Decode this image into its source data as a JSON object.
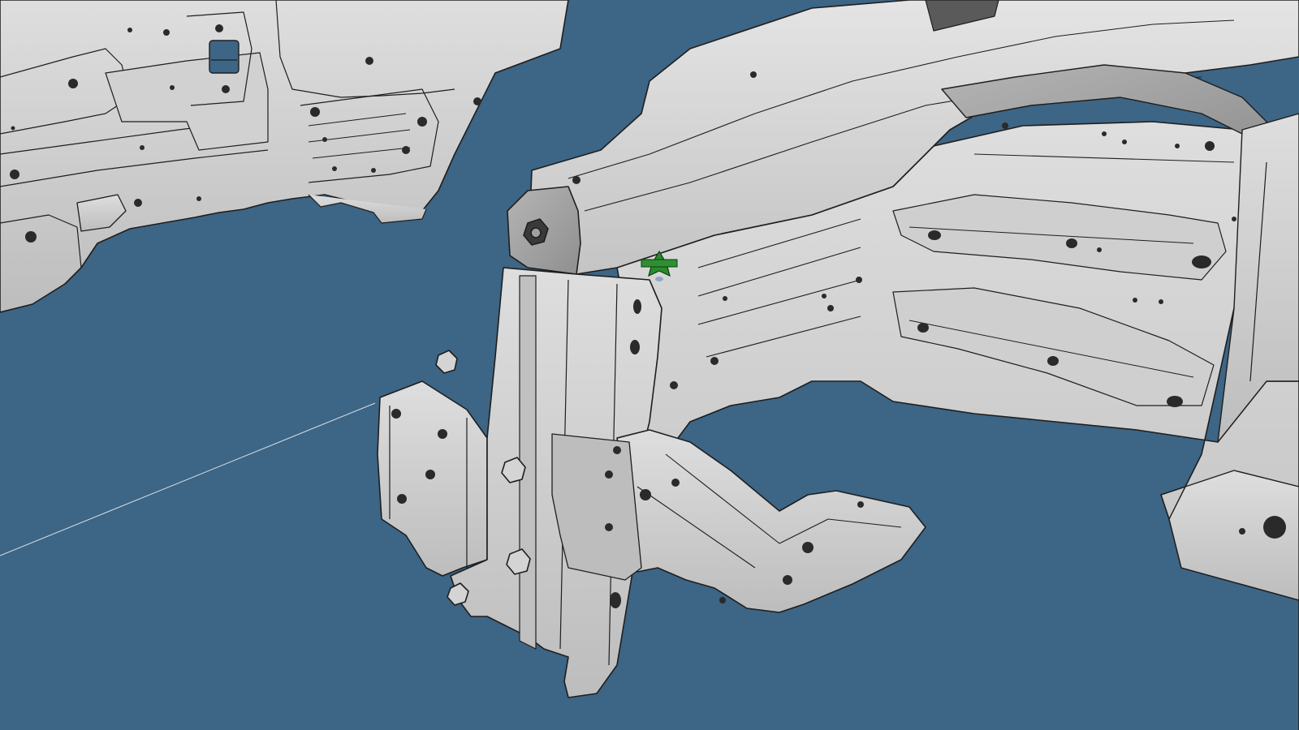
{
  "viewer": {
    "background_color": "#3d6585",
    "part_fill_color": "#c9c9c9",
    "part_shadow_color": "#9d9d9d",
    "part_edge_color": "#1e1e1e",
    "highlight_marker_color": "#2a8a2e",
    "highlight_marker_icon": "green-star-marker-icon",
    "text": ""
  }
}
